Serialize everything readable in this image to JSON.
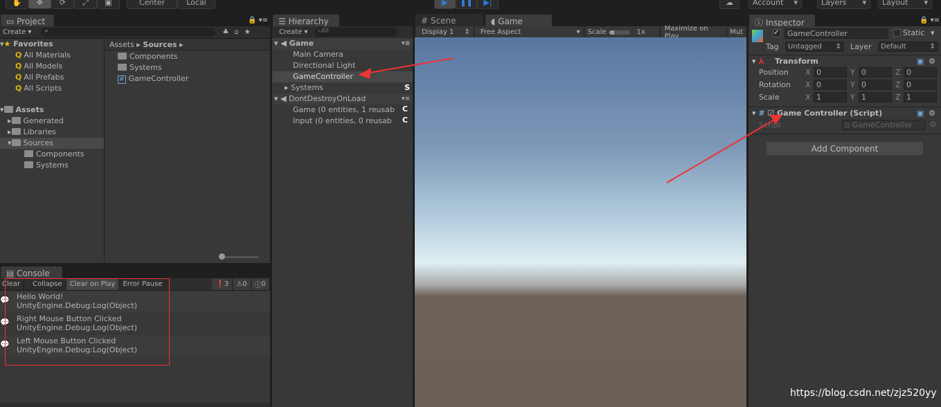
{
  "toolbar": {
    "tools": [
      "hand-icon",
      "move-icon",
      "rotate-icon",
      "scale-icon",
      "rect-icon"
    ],
    "pivot": "Center",
    "space": "Local",
    "account": "Account",
    "layers": "Layers",
    "layout": "Layout"
  },
  "project": {
    "tab": "Project",
    "create": "Create",
    "favorites_label": "Favorites",
    "favorites": [
      "All Materials",
      "All Models",
      "All Prefabs",
      "All Scripts"
    ],
    "assets_label": "Assets",
    "assets_tree": [
      "Generated",
      "Libraries",
      "Sources",
      "Components",
      "Systems"
    ],
    "breadcrumb": [
      "Assets",
      "Sources"
    ],
    "files": [
      "Components",
      "Systems",
      "GameController"
    ]
  },
  "hierarchy": {
    "tab": "Hierarchy",
    "create": "Create",
    "search_placeholder": "All",
    "scene1": "Game",
    "items1": [
      "Main Camera",
      "Directional Light",
      "GameController",
      "Systems"
    ],
    "systems_badge": "S",
    "scene2": "DontDestroyOnLoad",
    "items2": [
      "Game (0 entities, 1 reusab",
      "Input (0 entities, 0 reusab"
    ],
    "badge_c": "C"
  },
  "game": {
    "scene_tab": "Scene",
    "game_tab": "Game",
    "display": "Display 1",
    "aspect": "Free Aspect",
    "scale_label": "Scale",
    "scale_value": "1x",
    "maximize": "Maximize on Play",
    "mute": "Mut",
    "sky_colors": [
      "#5a76a0",
      "#dfeef2",
      "#6f6259"
    ]
  },
  "inspector": {
    "tab": "Inspector",
    "object_name": "GameController",
    "static": "Static",
    "tag_label": "Tag",
    "tag": "Untagged",
    "layer_label": "Layer",
    "layer": "Default",
    "transform": "Transform",
    "rows": [
      {
        "label": "Position",
        "x": "0",
        "y": "0",
        "z": "0"
      },
      {
        "label": "Rotation",
        "x": "0",
        "y": "0",
        "z": "0"
      },
      {
        "label": "Scale",
        "x": "1",
        "y": "1",
        "z": "1"
      }
    ],
    "axes": [
      "X",
      "Y",
      "Z"
    ],
    "script_component": "Game Controller (Script)",
    "script_label": "Script",
    "script_value": "GameController",
    "add_component": "Add Component"
  },
  "console": {
    "tab": "Console",
    "buttons": [
      "Clear",
      "Collapse",
      "Clear on Play",
      "Error Pause"
    ],
    "counts": {
      "info": "3",
      "warn": "0",
      "error": "0"
    },
    "logs": [
      {
        "msg": "Hello World!",
        "trace": "UnityEngine.Debug:Log(Object)"
      },
      {
        "msg": "Right Mouse Button Clicked",
        "trace": "UnityEngine.Debug:Log(Object)"
      },
      {
        "msg": "Left Mouse Button Clicked",
        "trace": "UnityEngine.Debug:Log(Object)"
      }
    ]
  },
  "watermark": "https://blog.csdn.net/zjz520yy",
  "annotation_color": "#ee3333"
}
